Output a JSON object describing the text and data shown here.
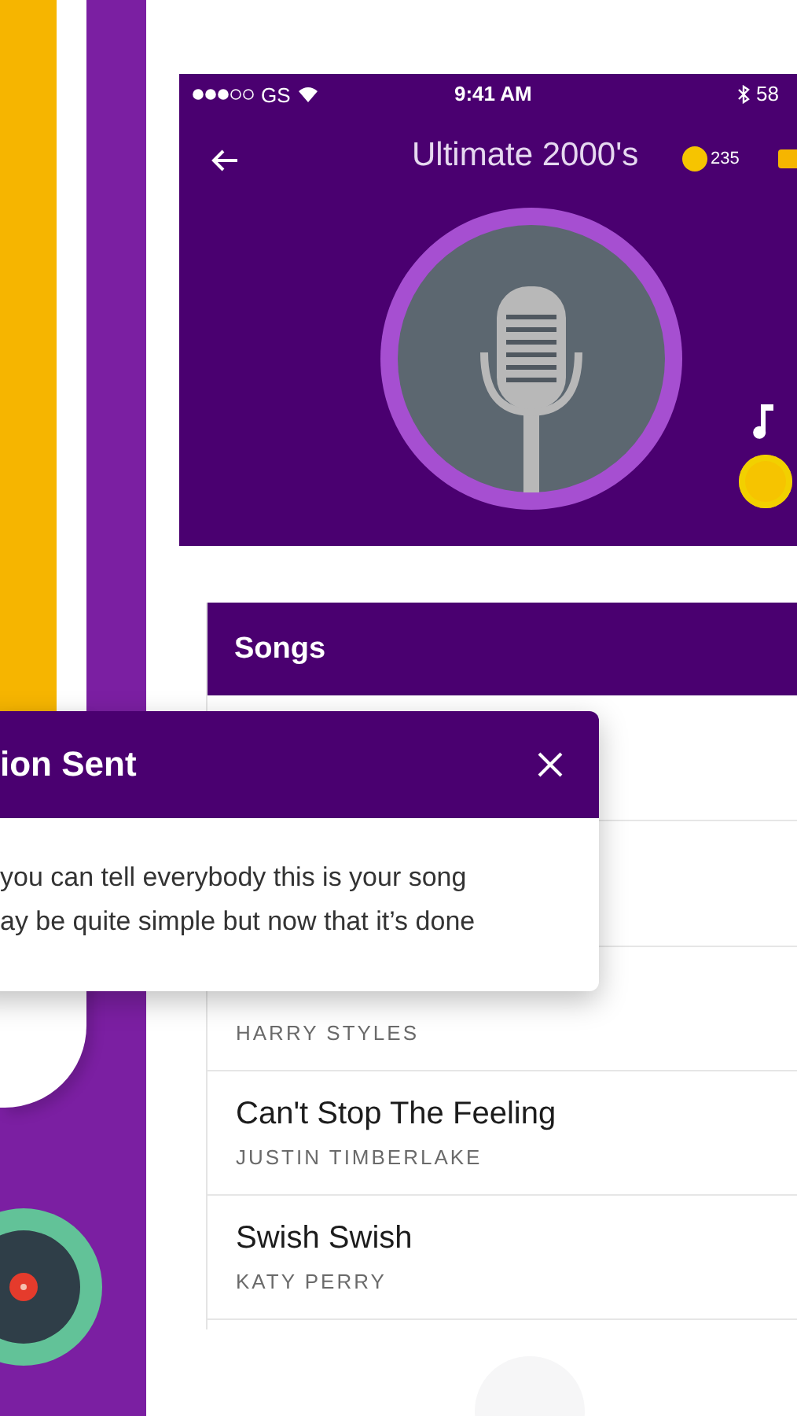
{
  "status_bar": {
    "carrier": "GS",
    "time": "9:41 AM",
    "battery": "58"
  },
  "header": {
    "title": "Ultimate 2000's",
    "coins": "235"
  },
  "songs": {
    "title": "Songs",
    "items": [
      {
        "artist": "HARRY STYLES"
      },
      {
        "title": "Can't Stop The Feeling",
        "artist": "JUSTIN TIMBERLAKE"
      },
      {
        "title": "Swish Swish",
        "artist": "KATY PERRY"
      }
    ]
  },
  "dialog": {
    "title": "ion Sent",
    "lines": [
      "you can tell everybody this is your song",
      "ay be quite simple but now that it’s done"
    ]
  }
}
